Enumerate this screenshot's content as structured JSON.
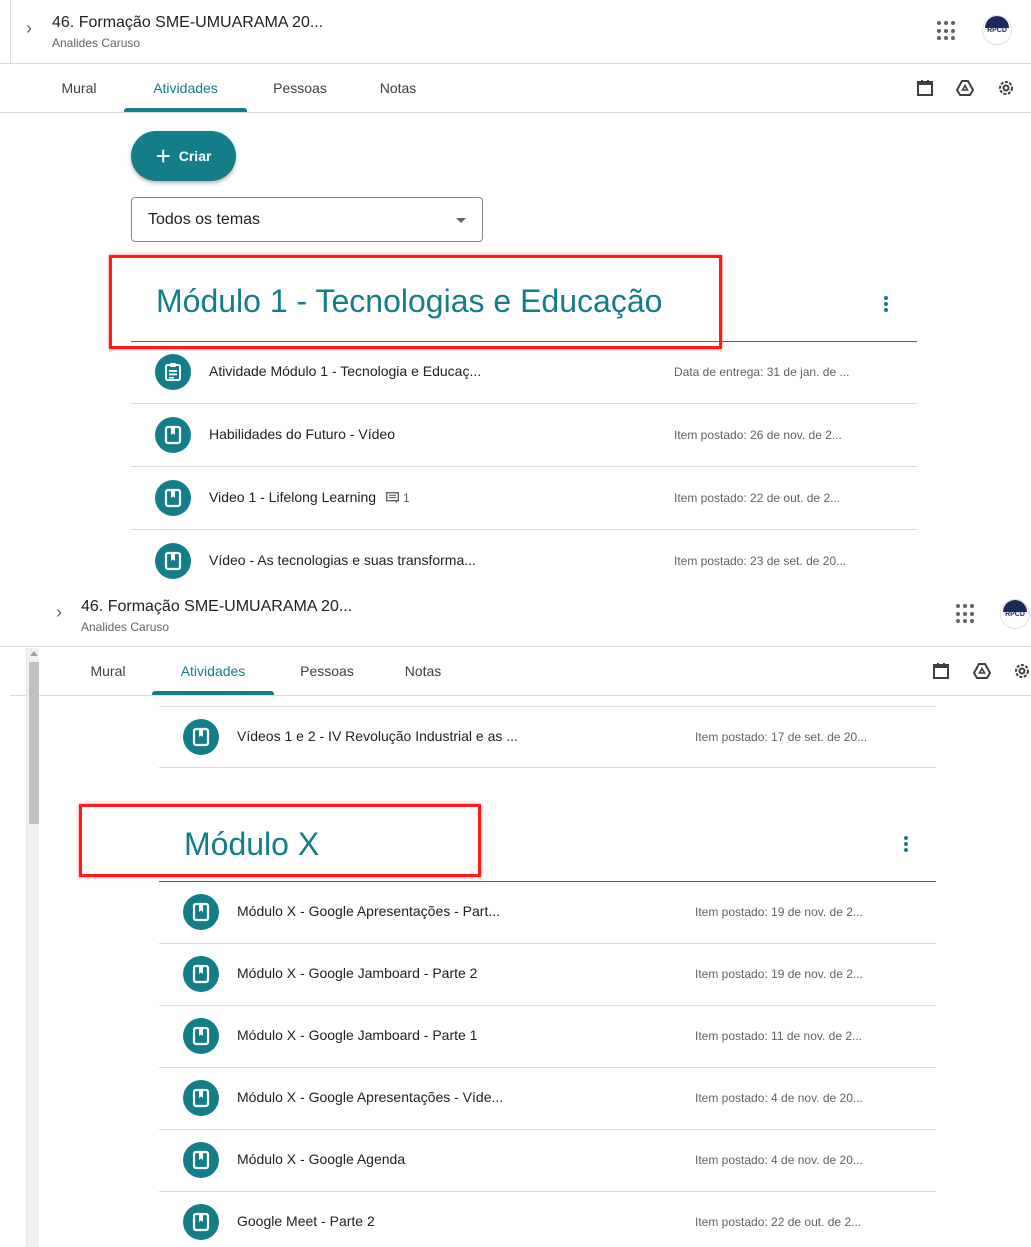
{
  "header": {
    "course_title": "46. Formação SME-UMUARAMA 20...",
    "course_owner": "Analides Caruso",
    "avatar_text": "RPCD"
  },
  "tabs": [
    "Mural",
    "Atividades",
    "Pessoas",
    "Notas"
  ],
  "active_tab": "Atividades",
  "create_button": {
    "label": "Criar"
  },
  "topic_filter": {
    "selected": "Todos os temas"
  },
  "topic1": {
    "title": "Módulo 1 - Tecnologias e Educação",
    "items": [
      {
        "icon": "assignment-icon",
        "title": "Atividade Módulo 1 - Tecnologia e Educaç...",
        "meta": "Data de entrega: 31 de jan. de ..."
      },
      {
        "icon": "material-icon",
        "title": "Habilidades do Futuro - Vídeo",
        "meta": "Item postado: 26 de nov. de 2..."
      },
      {
        "icon": "material-icon",
        "title": "Video 1 - Lifelong Learning",
        "comments": "1",
        "meta": "Item postado: 22 de out. de 2..."
      },
      {
        "icon": "material-icon",
        "title": "Vídeo - As tecnologias e suas transforma...",
        "meta": "Item postado: 23 de set. de 20..."
      }
    ]
  },
  "topic1_tail": {
    "title": "Vídeos 1 e 2 - IV Revolução Industrial e as ...",
    "meta": "Item postado: 17 de set. de 20..."
  },
  "topic2": {
    "title": "Módulo X",
    "items": [
      {
        "title": "Módulo X - Google Apresentações - Part...",
        "meta": "Item postado: 19 de nov. de 2..."
      },
      {
        "title": "Módulo X - Google Jamboard - Parte 2",
        "meta": "Item postado: 19 de nov. de 2..."
      },
      {
        "title": "Módulo X - Google Jamboard - Parte 1",
        "meta": "Item postado: 11 de nov. de 2..."
      },
      {
        "title": "Módulo X - Google Apresentações - Víde...",
        "meta": "Item postado: 4 de nov. de 20..."
      },
      {
        "title": "Módulo X - Google Agenda",
        "meta": "Item postado: 4 de nov. de 20..."
      },
      {
        "title": "Google Meet - Parte 2",
        "meta": "Item postado: 22 de out. de 2..."
      }
    ]
  },
  "colors": {
    "accent": "#137e8a",
    "highlight": "#ff1a1a"
  }
}
